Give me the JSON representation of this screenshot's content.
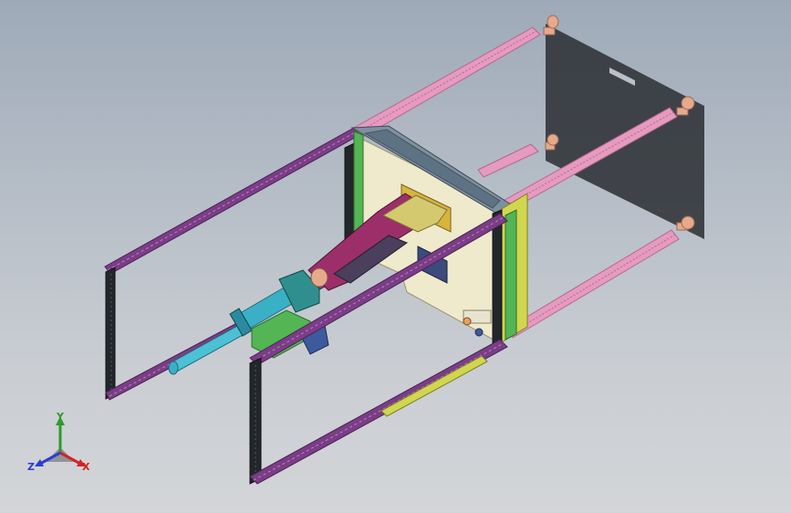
{
  "viewport": {
    "background_top": "#9eaab8",
    "background_bottom": "#d3d5d8"
  },
  "model": {
    "colors": {
      "purple_profile": "#7a3d86",
      "purple_dark": "#4c2256",
      "pink_rail": "#e59bbf",
      "pink_dark": "#b8648f",
      "column_black": "#22272b",
      "plate_cream": "#efeacc",
      "frame_steel": "#7e91a0",
      "frame_green": "#53b553",
      "frame_yellow": "#d1d64f",
      "arm_magenta": "#9c2f6a",
      "cylinder_cyan": "#3ab0c7",
      "block_teal": "#2f8f8f",
      "foot_tan": "#e6a98c",
      "shadow": "#2a2e33"
    }
  },
  "triad": {
    "y_label": "Y",
    "x_label": "X",
    "z_label": "Z",
    "y_color": "#2c9b2c",
    "x_color": "#d02424",
    "z_color": "#2a3ed0"
  }
}
